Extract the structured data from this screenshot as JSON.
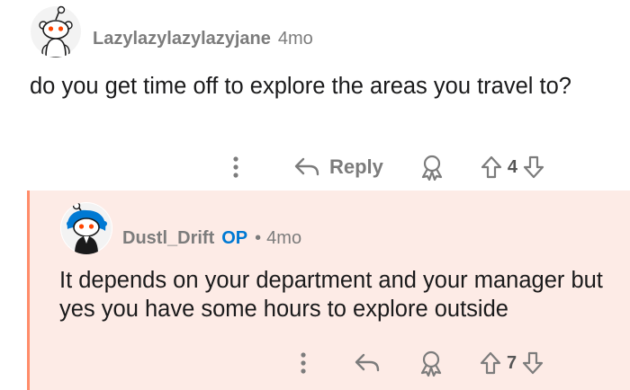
{
  "comments": [
    {
      "username": "Lazylazylazylazyjane",
      "age": "4mo",
      "body": "do you get time off to explore the areas you travel to?",
      "actions": {
        "reply_label": "Reply",
        "vote_count": "4"
      },
      "icons": [
        "more-vertical-icon",
        "reply-arrow-icon",
        "award-icon",
        "upvote-icon",
        "downvote-icon"
      ]
    },
    {
      "username": "Dustl_Drift",
      "op_badge": "OP",
      "separator": "•",
      "age": "4mo",
      "body": "It depends on your department and your manager but yes you have some hours to explore outside",
      "actions": {
        "vote_count": "7"
      },
      "icons": [
        "more-vertical-icon",
        "reply-arrow-icon",
        "award-icon",
        "upvote-icon",
        "downvote-icon"
      ]
    }
  ],
  "colors": {
    "op_highlight_bg": "#fdebe6",
    "op_highlight_border": "#ff8c6a",
    "op_badge": "#0079d3",
    "muted_text": "#7c7c7c",
    "snoo_orange": "#ff4500",
    "snoo_blue": "#0079d3"
  }
}
